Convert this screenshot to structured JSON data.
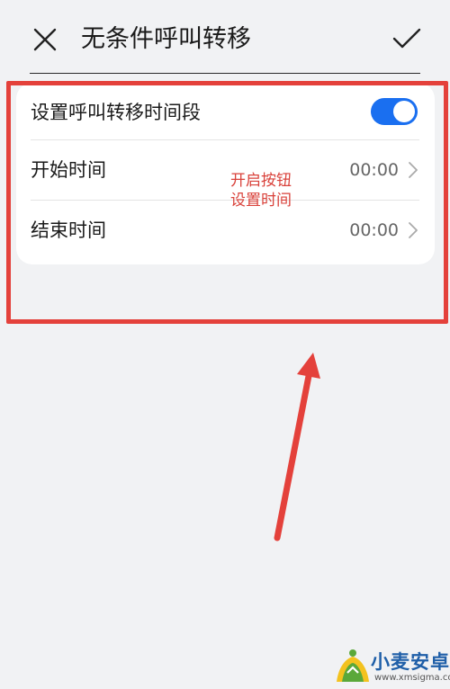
{
  "header": {
    "title": "无条件呼叫转移",
    "close_icon": "close-icon",
    "confirm_icon": "checkmark-icon"
  },
  "settings": {
    "rows": [
      {
        "label": "设置呼叫转移时间段",
        "control": "toggle",
        "enabled": true
      },
      {
        "label": "开始时间",
        "value": "00:00"
      },
      {
        "label": "结束时间",
        "value": "00:00"
      }
    ]
  },
  "annotation": {
    "line1": "开启按钮",
    "line2": "设置时间",
    "color": "#e4413b"
  },
  "watermark": {
    "name": "小麦安卓网",
    "url": "www.xmsigma.com"
  },
  "colors": {
    "accent": "#1a6ff0",
    "background": "#f1f2f4"
  }
}
